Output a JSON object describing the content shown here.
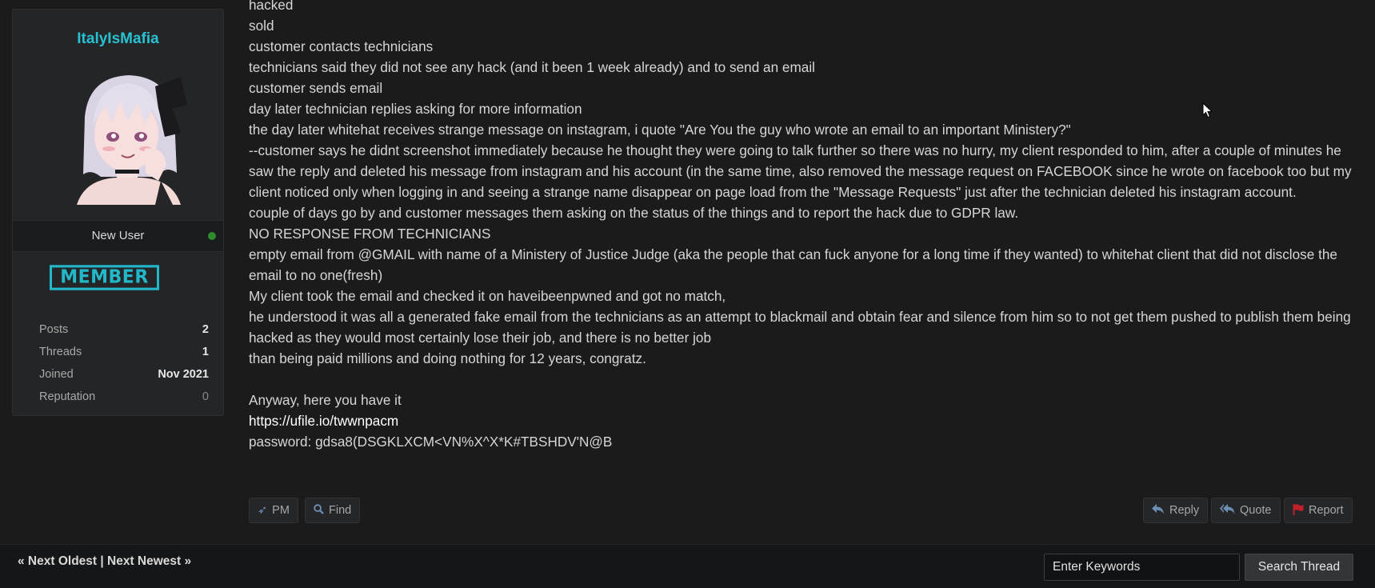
{
  "user": {
    "name": "ItalyIsMafia",
    "title": "New User",
    "badge": "MEMBER",
    "stats": [
      {
        "label": "Posts",
        "value": "2"
      },
      {
        "label": "Threads",
        "value": "1"
      },
      {
        "label": "Joined",
        "value": "Nov 2021"
      },
      {
        "label": "Reputation",
        "value": "0"
      }
    ]
  },
  "post": {
    "lines": [
      "hacked",
      "sold",
      "customer contacts technicians",
      "technicians said they did not see any hack (and it been 1 week already) and to send an email",
      "customer sends email",
      "day later technician replies asking for more information",
      "the day later whitehat receives strange message on instagram, i quote \"Are You the guy who wrote an email to an important Ministery?\"",
      "--customer says he didnt screenshot immediately because he thought they were going to talk further so there was no hurry, my client responded to him, after a couple of minutes he saw the reply and deleted his message from instagram and his account (in the same time, also removed the message request on FACEBOOK since he wrote on facebook too but my client noticed only when logging in and seeing a strange name disappear on page load from the \"Message Requests\" just after the technician deleted his instagram account.",
      "couple of days go by and customer messages them asking on the status of the things and to report the hack due to GDPR law.",
      "NO RESPONSE FROM TECHNICIANS",
      "empty email from @GMAIL with name of a Ministery of Justice Judge (aka the people that can fuck anyone for a long time if they wanted) to whitehat client that did not disclose the email to no one(fresh)",
      "My client took the email and checked it on haveibeenpwned and got no match,",
      "he understood it was all a generated fake email from the technicians as an attempt to blackmail and obtain fear and silence from him so to not get them pushed to publish them being hacked as they would most certainly lose their job, and there is no better job",
      "than being paid millions and doing nothing for 12 years, congratz."
    ],
    "closing": "Anyway, here you have it",
    "link": "https://ufile.io/twwnpacm",
    "password_line": "password: gdsa8(DSGKLXCM<VN%X^X*K#TBSHDV'N@B"
  },
  "actions": {
    "pm": "PM",
    "find": "Find",
    "reply": "Reply",
    "quote": "Quote",
    "report": "Report"
  },
  "footer": {
    "next_oldest": "« Next Oldest",
    "separator": "|",
    "next_newest": "Next Newest »",
    "search_placeholder": "Enter Keywords",
    "search_button": "Search Thread"
  },
  "colors": {
    "accent": "#29c1d1",
    "online": "#2e8b2e",
    "report_flag": "#c0202a"
  }
}
